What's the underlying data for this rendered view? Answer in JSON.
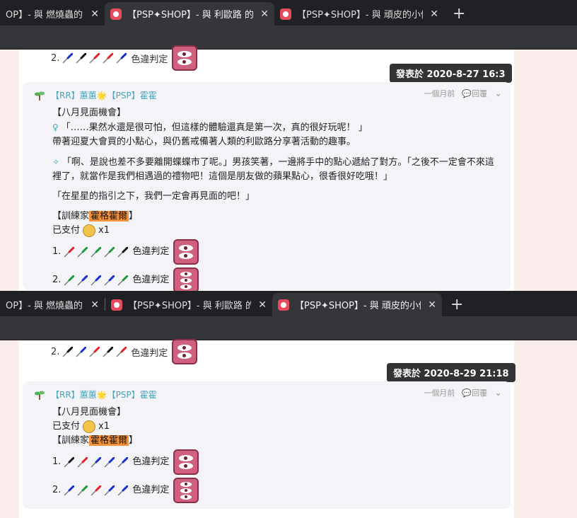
{
  "screens": [
    {
      "tabs": [
        {
          "title": "OP】- 與 燃燒蟲的 再",
          "active": false
        },
        {
          "title": "【PSP✦SHOP】- 與 利歐路 的 再",
          "active": true
        },
        {
          "title": "【PSP✦SHOP】- 與 頑皮的小傢",
          "active": false
        }
      ],
      "prev_line": {
        "num": "2.",
        "pins": [
          "blue",
          "black",
          "red",
          "red",
          "blue"
        ],
        "label": "色違判定",
        "eyes": 2
      },
      "tooltip": "發表於 2020-8-27 16:3",
      "comment": {
        "author": "【RR】蕙蕙🌟【PSP】霍霍",
        "time": "一個月前",
        "reply": "回覆",
        "lines": [
          "【八月見面機會】",
          "「……果然水還是很可怕，但這樣的體驗還真是第一次，真的很好玩呢！ 」",
          "帶著迎夏大會買的小點心，與仍舊戒備著人類的利歐路分享著活動的趣事。",
          "「啊、是說也差不多要離開蝶蝶市了呢。」男孩笑著，一邊將手中的點心遞給了對方。「之後不一定會不來這裡了，就當作是我們相遇過的禮物吧！這個是朋友做的蘋果點心，很香很好吃哦！」",
          "「在星星的指引之下，我們一定會再見面的吧！」"
        ],
        "trainer_prefix": "【訓練家",
        "trainer_name": "霍格霍爾",
        "trainer_suffix": "】",
        "paid": "已支付",
        "paid_count": "x1",
        "rolls": [
          {
            "num": "1.",
            "pins": [
              "red",
              "green",
              "green",
              "green",
              "black"
            ],
            "label": "色違判定",
            "eyes": 2
          },
          {
            "num": "2.",
            "pins": [
              "green",
              "blue",
              "blue",
              "blue",
              "green"
            ],
            "label": "色違判定",
            "eyes": 3
          }
        ]
      }
    },
    {
      "tabs": [
        {
          "title": "OP】- 與 燃燒蟲的 再",
          "active": false
        },
        {
          "title": "【PSP✦SHOP】- 與 利歐路 的 再",
          "active": false
        },
        {
          "title": "【PSP✦SHOP】- 與 頑皮的小傢",
          "active": true
        }
      ],
      "prev_line": {
        "num": "2.",
        "pins": [
          "black",
          "blue",
          "red",
          "black",
          "red"
        ],
        "label": "色違判定",
        "eyes": 2
      },
      "tooltip": "發表於 2020-8-29 21:18",
      "comment": {
        "author": "【RR】蕙蕙🌟【PSP】霍霍",
        "time": "一個月前",
        "reply": "回覆",
        "lines": [
          "【八月見面機會】"
        ],
        "paid": "已支付",
        "paid_count": "x1",
        "trainer_prefix": "【訓練家",
        "trainer_name": "霍格霍爾",
        "trainer_suffix": "】",
        "rolls": [
          {
            "num": "1.",
            "pins": [
              "black",
              "red",
              "blue",
              "blue",
              "blue"
            ],
            "label": "色違判定",
            "eyes": 2
          },
          {
            "num": "2.",
            "pins": [
              "blue",
              "green",
              "red",
              "blue",
              "blue"
            ],
            "label": "色違判定",
            "eyes": 3
          }
        ]
      }
    }
  ],
  "colors": {
    "red": "#e0202a",
    "blue": "#1a2fd0",
    "green": "#1f9a3a",
    "black": "#111111",
    "highlight": "#f4933a",
    "tab_bg": "#202124",
    "tab_active": "#35363a"
  }
}
